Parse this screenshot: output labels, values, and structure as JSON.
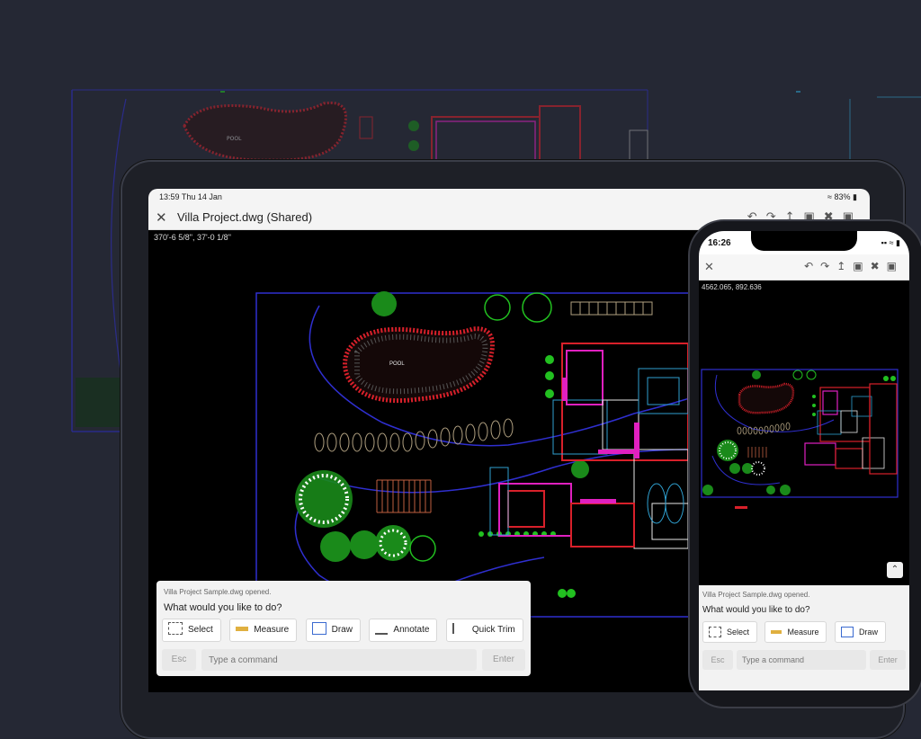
{
  "tablet": {
    "status_time": "13:59  Thu 14 Jan",
    "status_battery": "83%",
    "file_title": "Villa Project.dwg (Shared)",
    "coordinates": "370'-6 5/8\",  37'-0 1/8\"",
    "command_panel": {
      "message": "Villa Project Sample.dwg opened.",
      "question": "What would you like to do?",
      "buttons": [
        "Select",
        "Measure",
        "Draw",
        "Annotate",
        "Quick Trim"
      ],
      "esc_label": "Esc",
      "input_placeholder": "Type a command",
      "enter_label": "Enter"
    }
  },
  "phone": {
    "status_time": "16:26",
    "coordinates": "4562.065,  892.636",
    "command_panel": {
      "message": "Villa Project Sample.dwg opened.",
      "question": "What would you like to do?",
      "buttons": [
        "Select",
        "Measure",
        "Draw"
      ],
      "esc_label": "Esc",
      "input_placeholder": "Type a command",
      "enter_label": "Enter"
    }
  },
  "drawing": {
    "pool_label": "POOL"
  },
  "colors": {
    "background": "#252834",
    "cad_blue": "#2f2fd0",
    "cad_red": "#d8202a",
    "cad_magenta": "#e020c0",
    "cad_green": "#22c020",
    "cad_white": "#e8e8e8"
  },
  "icons": [
    "close-icon",
    "undo-icon",
    "redo-icon",
    "share-icon",
    "save-icon",
    "hide-icon",
    "fullscreen-icon",
    "wifi-icon",
    "battery-icon",
    "select-icon",
    "measure-icon",
    "draw-icon",
    "annotate-icon",
    "quick-trim-icon",
    "scroll-up-icon"
  ]
}
